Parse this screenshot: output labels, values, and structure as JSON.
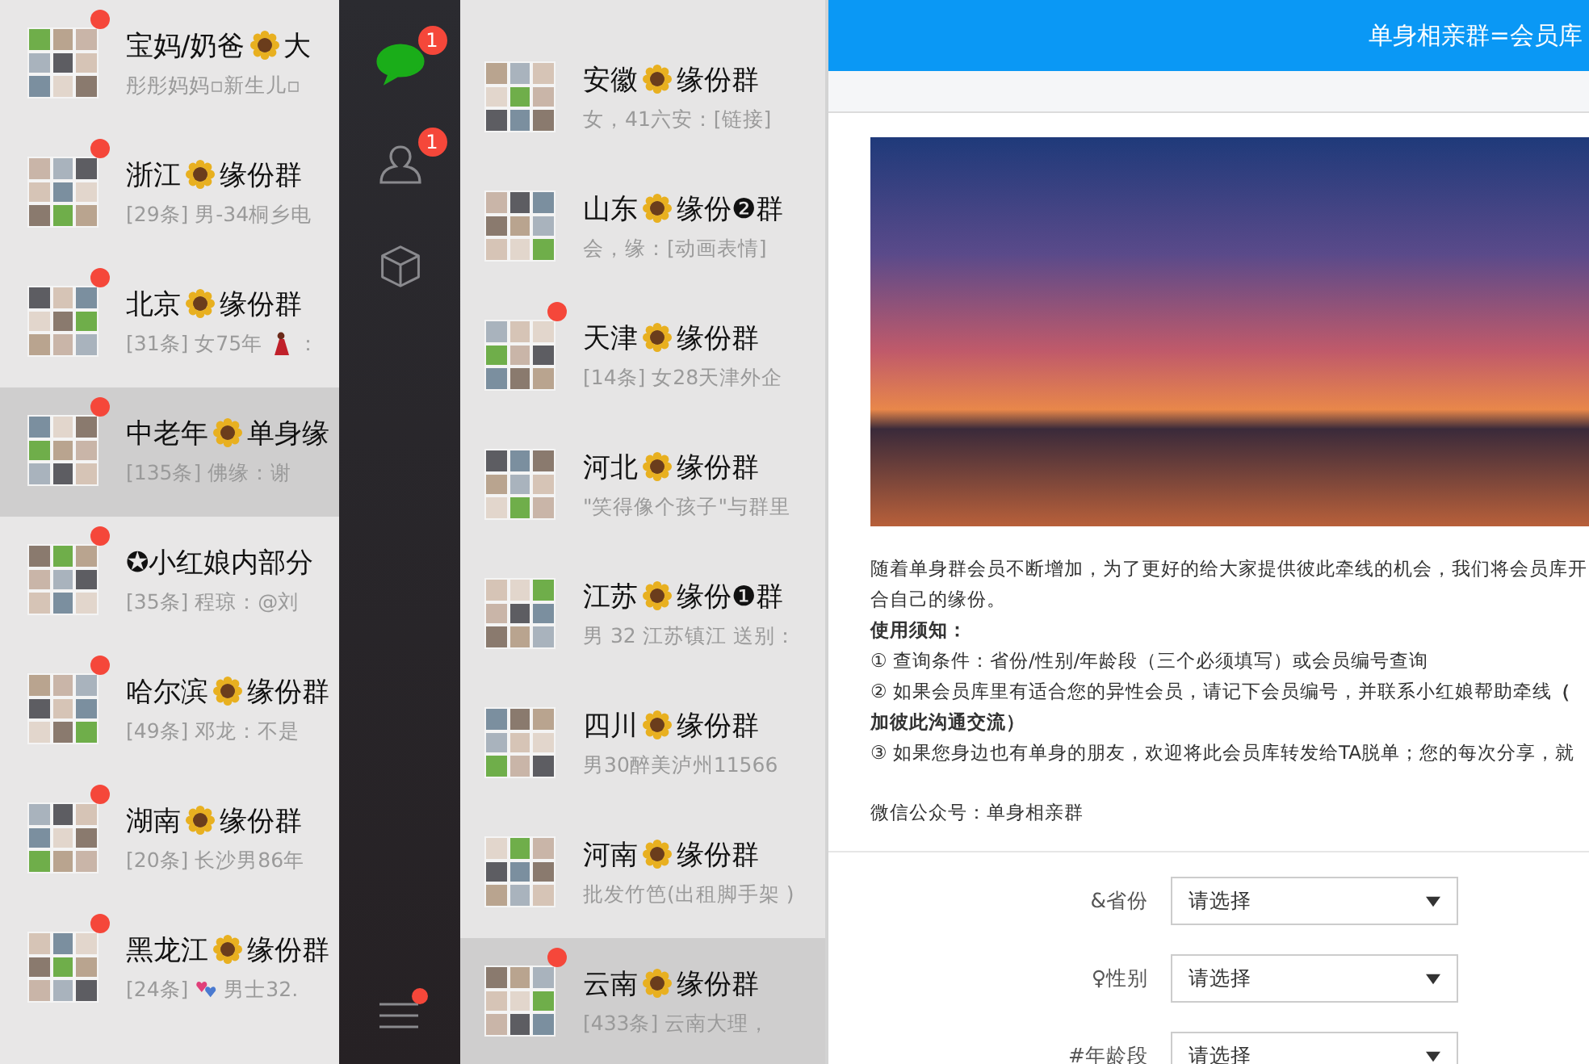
{
  "left_list": {
    "items": [
      {
        "title": "宝妈/奶爸",
        "title_after": "大",
        "preview": "彤彤妈妈▫新生儿▫",
        "unread": true,
        "selected": false
      },
      {
        "title": "浙江",
        "title_after": "缘份群",
        "preview": "[29条] 男-34桐乡电",
        "unread": true,
        "selected": false
      },
      {
        "title": "北京",
        "title_after": "缘份群",
        "preview": "[31条] 女75年",
        "preview_emoji": {
          "kind": "dancer"
        },
        "preview_after": "：",
        "unread": true,
        "selected": false
      },
      {
        "title": "中老年",
        "title_after": "单身缘",
        "preview": "[135条] 佛缘：谢",
        "unread": true,
        "selected": true
      },
      {
        "title": "✪小红娘内部分",
        "preview": "[35条] 程琼：@刘",
        "unread": true,
        "selected": false
      },
      {
        "title": "哈尔滨",
        "title_after": "缘份群",
        "preview": "[49条] 邓龙：不是",
        "unread": true,
        "selected": false
      },
      {
        "title": "湖南",
        "title_after": "缘份群",
        "preview": "[20条] 长沙男86年",
        "unread": true,
        "selected": false
      },
      {
        "title": "黑龙江",
        "title_after": "缘份群",
        "preview": "[24条]",
        "preview_emoji": {
          "kind": "hearts"
        },
        "preview_after": "男士32.",
        "unread": true,
        "selected": false
      }
    ]
  },
  "sidebar": {
    "items": [
      {
        "kind": "chat",
        "badge": "1",
        "selected": true
      },
      {
        "kind": "contacts",
        "badge": "1",
        "selected": false
      },
      {
        "kind": "cube",
        "selected": false
      }
    ],
    "menu": {
      "unread": true
    }
  },
  "middle_list": {
    "items": [
      {
        "title": "安徽",
        "title_after": "缘份群",
        "preview": "女，41六安：[链接]",
        "unread": false,
        "selected": false
      },
      {
        "title": "山东",
        "title_after": "缘份❷群",
        "preview": "会，缘：[动画表情]",
        "unread": false,
        "selected": false
      },
      {
        "title": "天津",
        "title_after": "缘份群",
        "preview": "[14条] 女28天津外企",
        "unread": true,
        "selected": false
      },
      {
        "title": "河北",
        "title_after": "缘份群",
        "preview": "\"笑得像个孩子\"与群里",
        "unread": false,
        "selected": false
      },
      {
        "title": "江苏",
        "title_after": "缘份❶群",
        "preview": "男 32 江苏镇江 送别：",
        "unread": false,
        "selected": false
      },
      {
        "title": "四川",
        "title_after": "缘份群",
        "preview": "男30醉美泸州11566",
        "unread": false,
        "selected": false
      },
      {
        "title": "河南",
        "title_after": "缘份群",
        "preview": "批发竹笆(出租脚手架 )",
        "unread": false,
        "selected": false
      },
      {
        "title": "云南",
        "title_after": "缘份群",
        "preview": "[433条] 云南大理，",
        "unread": true,
        "selected": true
      }
    ]
  },
  "webview": {
    "title": "单身相亲群=会员库",
    "notice": [
      {
        "text": "随着单身群会员不断增加，为了更好的给大家提供彼此牵线的机会，我们将会员库开",
        "bold": false
      },
      {
        "text": "合自己的缘份。",
        "bold": false
      },
      {
        "text": "使用须知：",
        "bold": true
      },
      {
        "text": "① 查询条件：省份/性别/年龄段（三个必须填写）或会员编号查询",
        "bold": false
      },
      {
        "text": "② 如果会员库里有适合您的异性会员，请记下会员编号，并联系小红娘帮助牵线**（**",
        "bold": false
      },
      {
        "text": "加彼此沟通交流）",
        "bold": true
      },
      {
        "text": "③ 如果您身边也有单身的朋友，欢迎将此会员库转发给TA脱单；您的每次分享，就",
        "bold": false
      }
    ],
    "account": "微信公众号：单身相亲群",
    "form": [
      {
        "label": "&省份",
        "placeholder": "请选择"
      },
      {
        "label": "♀性别",
        "placeholder": "请选择"
      },
      {
        "label": "#年龄段",
        "placeholder": "请选择"
      }
    ]
  }
}
